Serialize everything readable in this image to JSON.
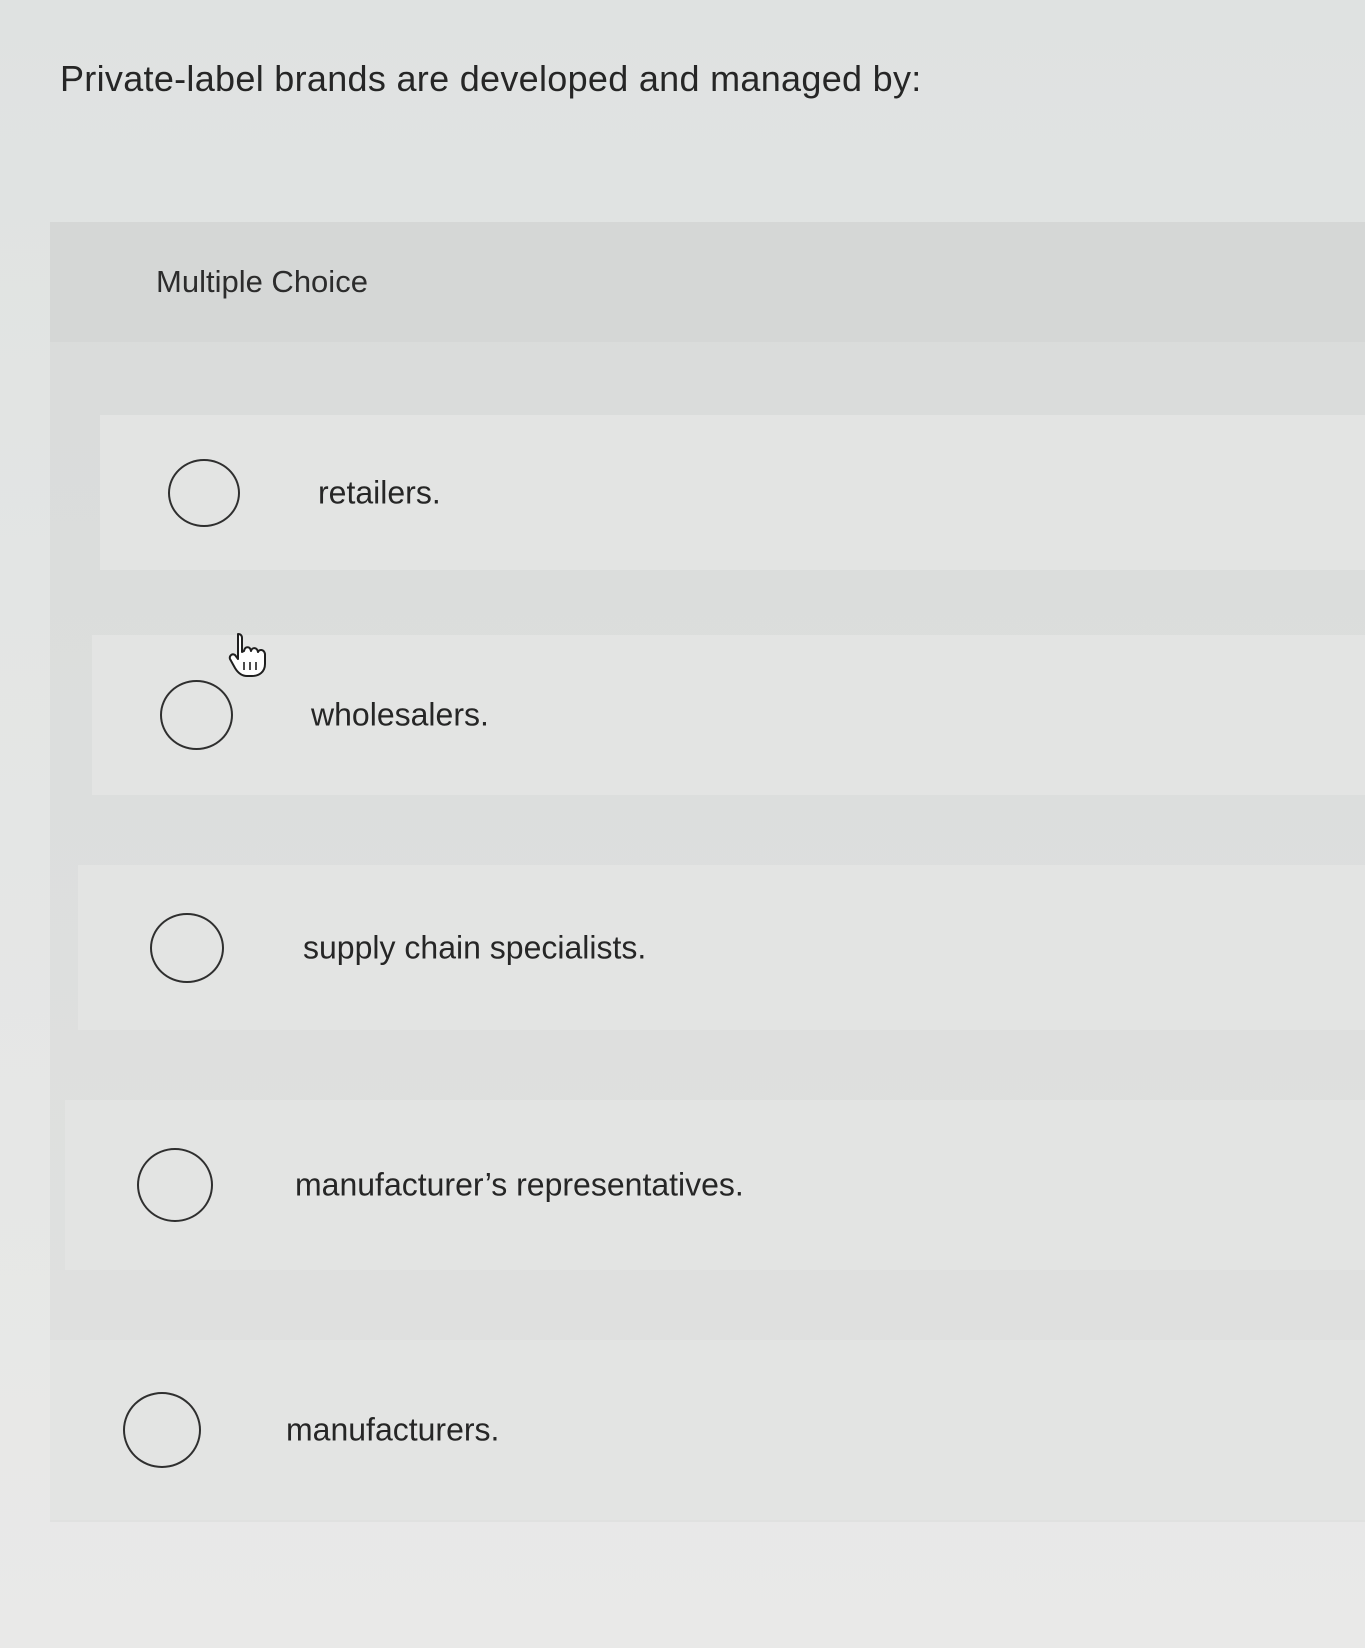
{
  "question": {
    "text": "Private-label brands are developed and managed by:"
  },
  "panel": {
    "label": "Multiple Choice"
  },
  "options": [
    {
      "label": "retailers."
    },
    {
      "label": "wholesalers."
    },
    {
      "label": "supply chain specialists."
    },
    {
      "label": "manufacturer’s representatives."
    },
    {
      "label": "manufacturers."
    }
  ],
  "icons": {
    "cursor": "pointer-hand-icon",
    "radio": "radio-unchecked-icon"
  },
  "colors": {
    "text": "#262626",
    "radio_border": "#2f2f2f",
    "background": "#e3e5e4"
  }
}
